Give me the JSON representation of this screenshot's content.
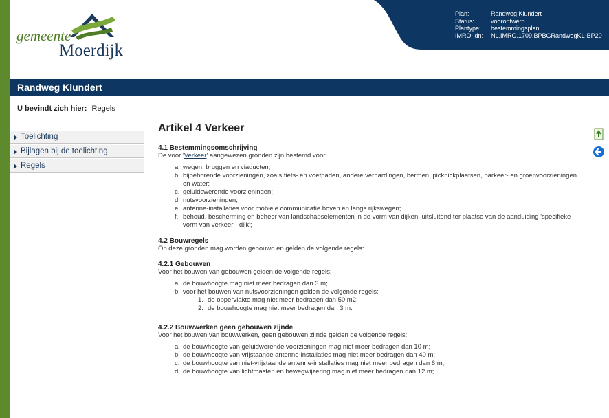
{
  "header": {
    "logo_word1": "gemeente",
    "logo_word2": "Moerdijk",
    "info": [
      {
        "key": "Plan:",
        "value": "Randweg Klundert"
      },
      {
        "key": "Status:",
        "value": "voorontwerp"
      },
      {
        "key": "Plantype:",
        "value": "bestemmingsplan"
      },
      {
        "key": "IMRO-idn:",
        "value": "NL.IMRO.1709.BPBGRandwegKL-BP20"
      }
    ]
  },
  "titlebar": {
    "title": "Randweg Klundert"
  },
  "breadcrumb": {
    "label": "U bevindt zich hier:",
    "current": "Regels"
  },
  "sidebar": {
    "items": [
      {
        "label": "Toelichting"
      },
      {
        "label": "Bijlagen bij de toelichting"
      },
      {
        "label": "Regels"
      }
    ]
  },
  "content": {
    "title": "Artikel 4 Verkeer",
    "s1": {
      "heading": "4.1 Bestemmingsomschrijving",
      "intro_pre": "De voor '",
      "intro_link": "Verkeer",
      "intro_post": "' aangewezen gronden zijn bestemd voor:",
      "items": [
        {
          "mk": "a.",
          "text": "wegen, bruggen en viaducten;"
        },
        {
          "mk": "b.",
          "text": "bijbehorende voorzieningen, zoals fiets- en voetpaden, andere verhardingen, bermen, picknickplaatsen, parkeer- en groenvoorzieningen en water;"
        },
        {
          "mk": "c.",
          "text": "geluidswerende voorzieningen;"
        },
        {
          "mk": "d.",
          "text": "nutsvoorzieningen;"
        },
        {
          "mk": "e.",
          "text": "antenne-installaties voor mobiele communicatie boven en langs rijkswegen;"
        },
        {
          "mk": "f.",
          "text": "behoud, bescherming en beheer van landschapselementen in de vorm van dijken, uitsluitend ter plaatse van de aanduiding 'specifieke vorm van verkeer - dijk';"
        }
      ]
    },
    "s2": {
      "heading": "4.2 Bouwregels",
      "intro": "Op deze gronden mag worden gebouwd en gelden de volgende regels:"
    },
    "s3": {
      "heading": "4.2.1 Gebouwen",
      "intro": "Voor het bouwen van gebouwen gelden de volgende regels:",
      "a": "de bouwhoogte mag niet meer bedragen dan 3 m;",
      "b": "voor het bouwen van nutsvoorzieningen gelden de volgende regels:",
      "sub1": "de oppervlakte mag niet meer bedragen dan 50 m2;",
      "sub2": "de bouwhoogte mag niet meer bedragen dan 3 m."
    },
    "s4": {
      "heading": "4.2.2 Bouwwerken geen gebouwen zijnde",
      "intro": "Voor het bouwen van bouwwerken, geen gebouwen zijnde gelden de volgende regels:",
      "items": [
        {
          "mk": "a.",
          "text": "de bouwhoogte van geluidwerende voorzieningen mag niet meer bedragen dan 10 m;"
        },
        {
          "mk": "b.",
          "text": "de bouwhoogte van vrijstaande antenne-installaties mag niet meer bedragen dan 40 m;"
        },
        {
          "mk": "c.",
          "text": "de bouwhoogte van niet-vrijstaande antenne-installaties mag niet meer bedragen dan 6 m;"
        },
        {
          "mk": "d.",
          "text": "de bouwhoogte van lichtmasten en bewegwijzering mag niet meer bedragen dan 12 m;"
        }
      ]
    }
  }
}
